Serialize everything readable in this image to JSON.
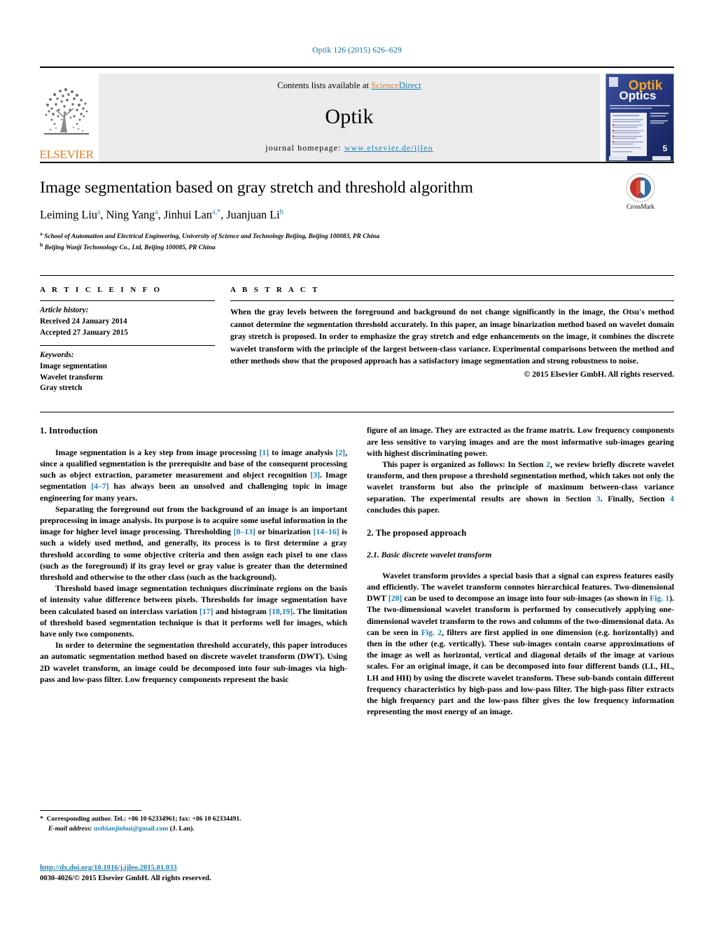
{
  "running_head": "Optik 126 (2015) 626–629",
  "masthead": {
    "publisher_name": "ELSEVIER",
    "contents_prefix": "Contents lists available at ",
    "contents_link": "ScienceDirect",
    "journal_title": "Optik",
    "homepage_label": "journal homepage:",
    "homepage_url": "www.elsevier.de/ijleo",
    "cover_title_top": "Optik",
    "cover_title_bottom": "Optics"
  },
  "article": {
    "title": "Image segmentation based on gray stretch and threshold algorithm",
    "authors": "Leiming Liu, Ning Yang, Jinhui Lan, Juanjuan Li",
    "authors_html_parts": [
      {
        "name": "Leiming Liu",
        "sup": "a",
        "sep": ", "
      },
      {
        "name": "Ning Yang",
        "sup": "a",
        "sep": ", "
      },
      {
        "name": "Jinhui Lan",
        "sup": "a,*",
        "sep": ", "
      },
      {
        "name": "Juanjuan Li",
        "sup": "b",
        "sep": ""
      }
    ],
    "affiliation_a": "School of Automation and Electrical Engineering, University of Science and Technology Beijing, Beijing 100083, PR China",
    "affiliation_a_marker": "a",
    "affiliation_b": "Beijing Wanji Techonology Co., Ltd, Beijing 100085, PR China",
    "affiliation_b_marker": "b",
    "crossmark_label": "CrossMark"
  },
  "article_info": {
    "heading": "A R T I C L E    I N F O",
    "history_label": "Article history:",
    "received": "Received 24 January 2014",
    "accepted": "Accepted 27 January 2015",
    "keywords_label": "Keywords:",
    "keywords": [
      "Image segmentation",
      "Wavelet transform",
      "Gray stretch"
    ]
  },
  "abstract": {
    "heading": "A B S T R A C T",
    "text": "When the gray levels between the foreground and background do not change significantly in the image, the Otsu's method cannot determine the segmentation threshold accurately. In this paper, an image binarization method based on wavelet domain gray stretch is proposed. In order to emphasize the gray stretch and edge enhancements on the image, it combines the discrete wavelet transform with the principle of the largest between-class variance. Experimental comparisons between the method and other methods show that the proposed approach has a satisfactory image segmentation and strong robustness to noise.",
    "copyright": "© 2015 Elsevier GmbH. All rights reserved."
  },
  "sections": {
    "introduction_heading": "1.  Introduction",
    "intro_p1_a": "Image segmentation is a key step from image processing ",
    "intro_p1_r1": "[1]",
    "intro_p1_b": " to image analysis ",
    "intro_p1_r2": "[2]",
    "intro_p1_c": ", since a qualified segmentation is the prerequisite and base of the consequent processing such as object extraction, parameter measurement and object recognition ",
    "intro_p1_r3": "[3]",
    "intro_p1_d": ". Image segmentation ",
    "intro_p1_r4": "[4–7]",
    "intro_p1_e": " has always been an unsolved and challenging topic in image engineering for many years.",
    "intro_p2_a": "Separating the foreground out from the background of an image is an important preprocessing in image analysis. Its purpose is to acquire some useful information in the image for higher level image processing. Thresholding ",
    "intro_p2_r1": "[8–13]",
    "intro_p2_b": " or binarization ",
    "intro_p2_r2": "[14–16]",
    "intro_p2_c": " is such a widely used method, and generally, its process is to first determine a gray threshold according to some objective criteria and then assign each pixel to one class (such as the foreground) if its gray level or gray value is greater than the determined threshold and otherwise to the other class (such as the background).",
    "intro_p3_a": "Threshold based image segmentation techniques discriminate regions on the basis of intensity value difference between pixels. Thresholds for image segmentation have been calculated based on interclass variation ",
    "intro_p3_r1": "[17]",
    "intro_p3_b": " and histogram ",
    "intro_p3_r2": "[18,19]",
    "intro_p3_c": ". The limitation of threshold based segmentation technique is that it performs well for images, which have only two components.",
    "intro_p4": "In order to determine the segmentation threshold accurately, this paper introduces an automatic segmentation method based on discrete wavelet transform (DWT). Using 2D wavelet transform, an image could be decomposed into four sub-images via high-pass and low-pass filter. Low frequency components represent the basic",
    "right_p1": "figure of an image. They are extracted as the frame matrix. Low frequency components are less sensitive to varying images and are the most informative sub-images gearing with highest discriminating power.",
    "right_p2_a": "This paper is organized as follows: In Section ",
    "right_p2_r1": "2",
    "right_p2_b": ", we review briefly discrete wavelet transform, and then propose a threshold segmentation method, which takes not only the wavelet transform but also the principle of maximum between-class variance separation. The experimental results are shown in Section ",
    "right_p2_r2": "3",
    "right_p2_c": ". Finally, Section ",
    "right_p2_r3": "4",
    "right_p2_d": " concludes this paper.",
    "proposed_heading": "2.  The proposed approach",
    "subsection_heading": "2.1.  Basic discrete wavelet transform",
    "right_p3_a": "Wavelet transform provides a special basis that a signal can express features easily and efficiently. The wavelet transform connotes hierarchical features. Two-dimensional DWT ",
    "right_p3_r1": "[20]",
    "right_p3_b": " can be used to decompose an image into four sub-images (as shown in ",
    "right_p3_r2": "Fig. 1",
    "right_p3_c": "). The two-dimensional wavelet transform is performed by consecutively applying one-dimensional wavelet transform to the rows and columns of the two-dimensional data. As can be seen in ",
    "right_p3_r3": "Fig. 2",
    "right_p3_d": ", filters are first applied in one dimension (e.g. horizontally) and then in the other (e.g. vertically). These sub-images contain coarse approximations of the image as well as horizontal, vertical and diagonal details of the image at various scales. For an original image, it can be decomposed into four different bands (LL, HL, LH and HH) by using the discrete wavelet transform. These sub-bands contain different frequency characteristics by high-pass and low-pass filter. The high-pass filter extracts the high frequency part and the low-pass filter gives the low frequency information representing the most energy of an image."
  },
  "footer": {
    "corresponding_marker": "*",
    "corresponding_text": "Corresponding author. Tel.: +86 10 62334961; fax: +86 10 62334491.",
    "email_label": "E-mail address:",
    "email": "ustblanjinhui@gmail.com",
    "email_owner": "(J. Lan).",
    "doi_url": "http://dx.doi.org/10.1016/j.ijleo.2015.01.033",
    "issn_line": "0030-4026/© 2015 Elsevier GmbH. All rights reserved."
  },
  "colors": {
    "link_blue": "#1b7fb5",
    "elsevier_orange": "#E87722",
    "band_gray": "#ebebeb",
    "cover_blue": "#2b3f87",
    "crossmark_red": "#c3352b",
    "crossmark_blue": "#2f6fa8"
  }
}
